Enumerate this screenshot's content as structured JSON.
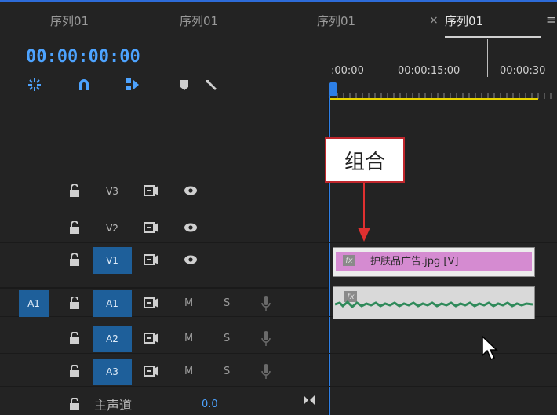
{
  "tabs": [
    {
      "label": "序列01"
    },
    {
      "label": "序列01"
    },
    {
      "label": "序列01"
    },
    {
      "label": "序列01"
    }
  ],
  "tab_close": "×",
  "tab_menu": "≡",
  "timecode": "00:00:00:00",
  "ruler": {
    "labels": [
      ":00:00",
      "00:00:15:00",
      "00:00:30"
    ]
  },
  "tracks": {
    "v3": {
      "name": "V3"
    },
    "v2": {
      "name": "V2"
    },
    "v1": {
      "name": "V1"
    },
    "a1": {
      "source": "A1",
      "name": "A1",
      "mute": "M",
      "solo": "S"
    },
    "a2": {
      "name": "A2",
      "mute": "M",
      "solo": "S"
    },
    "a3": {
      "name": "A3",
      "mute": "M",
      "solo": "S"
    }
  },
  "master": {
    "label": "主声道",
    "volume": "0.0"
  },
  "clips": {
    "video": {
      "fx": "fx",
      "label": "护肤品广告.jpg [V]"
    },
    "audio": {
      "fx": "fx"
    }
  },
  "callout": {
    "text": "组合"
  },
  "colors": {
    "accent": "#2d7fe6",
    "timecode": "#4da3ff",
    "video_clip": "#d58bd1",
    "audio_wave": "#2f8a5a",
    "callout_border": "#c0272d"
  }
}
